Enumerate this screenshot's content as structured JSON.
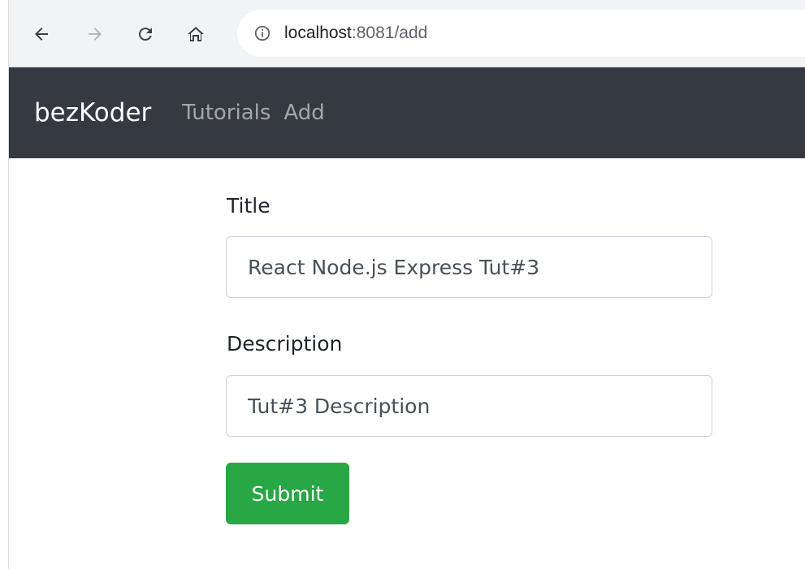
{
  "browser": {
    "url_host": "localhost",
    "url_rest": ":8081/add",
    "icons": [
      "back-arrow-icon",
      "forward-arrow-icon",
      "reload-icon",
      "home-icon",
      "info-icon"
    ]
  },
  "navbar": {
    "brand": "bezKoder",
    "links": [
      "Tutorials",
      "Add"
    ]
  },
  "form": {
    "title_label": "Title",
    "title_value": "React Node.js Express Tut#3",
    "description_label": "Description",
    "description_value": "Tut#3 Description",
    "submit_label": "Submit"
  },
  "colors": {
    "navbar_bg": "#343a40",
    "submit_bg": "#28a745"
  }
}
